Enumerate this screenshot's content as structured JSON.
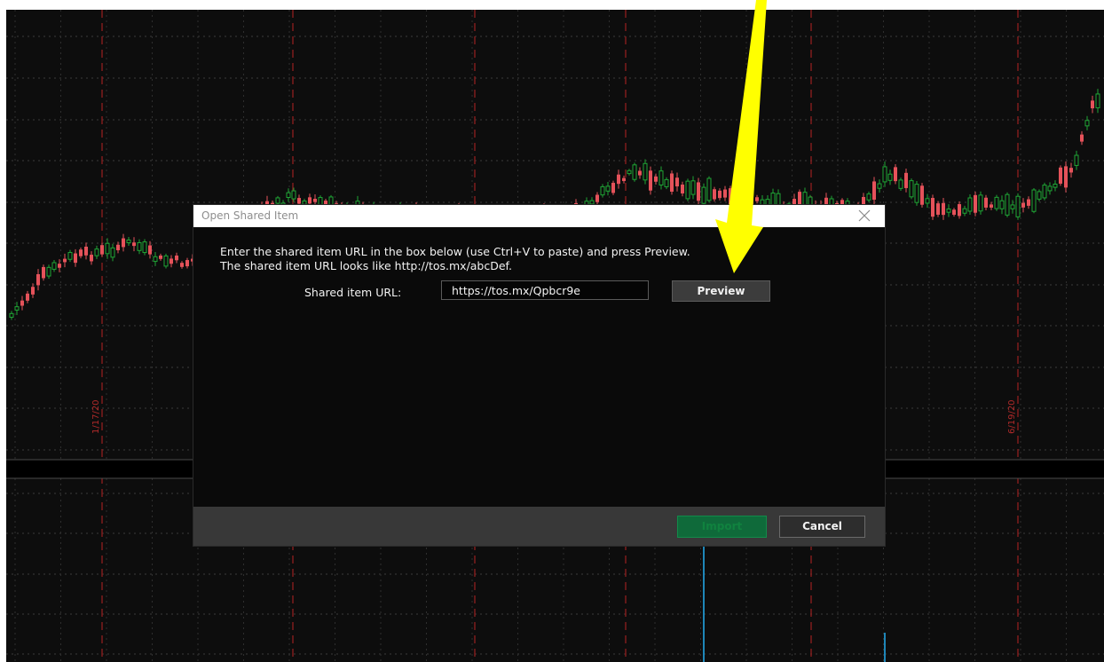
{
  "dialog": {
    "title": "Open Shared Item",
    "close_icon": "close-icon",
    "instruction_line1": "Enter the shared item URL in the box below (use Ctrl+V to paste) and press Preview.",
    "instruction_line2": "The shared item URL looks like http://tos.mx/abcDef.",
    "url_label": "Shared item URL:",
    "url_value": "https://tos.mx/Qpbcr9e",
    "preview_label": "Preview",
    "import_label": "Import",
    "cancel_label": "Cancel"
  },
  "chart": {
    "date_markers": [
      "1/17/20",
      "6/19/20"
    ],
    "colors": {
      "background": "#0d0d0d",
      "up_candle": "#1fa535",
      "down_candle": "#e5525a",
      "marker_line": "#9b1f1f",
      "volume_bar": "#1e86b8"
    }
  },
  "annotation": {
    "arrow_color": "#ffff00"
  }
}
